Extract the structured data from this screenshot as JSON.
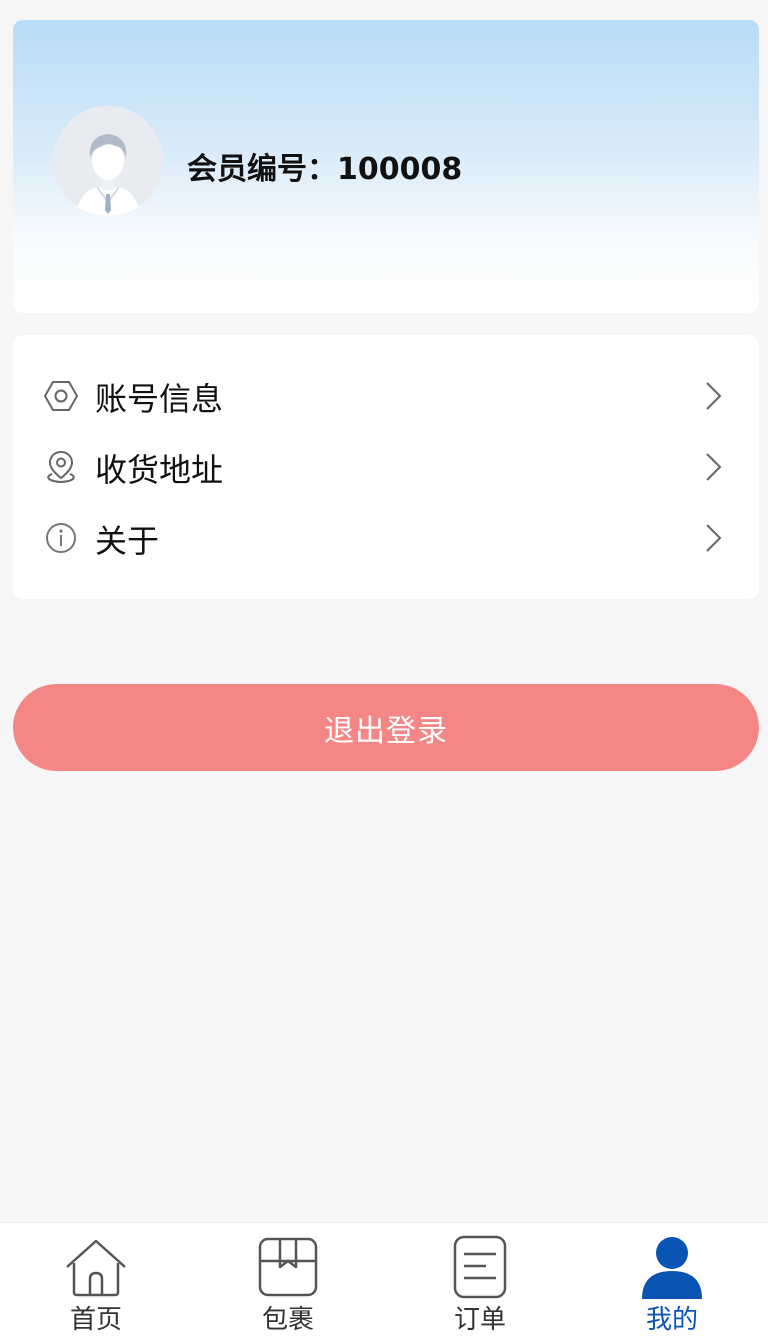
{
  "profile": {
    "member_label": "会员编号：",
    "member_id": "100008",
    "avatar_icon": "user-avatar-icon"
  },
  "menu": {
    "items": [
      {
        "label": "账号信息",
        "icon": "hexagon-settings-icon"
      },
      {
        "label": "收货地址",
        "icon": "location-pin-icon"
      },
      {
        "label": "关于",
        "icon": "info-icon"
      }
    ],
    "chevron_icon": "chevron-right-icon"
  },
  "logout": {
    "label": "退出登录",
    "color": "#f58686"
  },
  "tabbar": {
    "tabs": [
      {
        "label": "首页",
        "icon": "home-icon"
      },
      {
        "label": "包裹",
        "icon": "package-icon"
      },
      {
        "label": "订单",
        "icon": "order-list-icon"
      },
      {
        "label": "我的",
        "icon": "profile-icon"
      }
    ],
    "active_index": 3,
    "active_color": "#0a55b4",
    "inactive_color": "#333333"
  }
}
